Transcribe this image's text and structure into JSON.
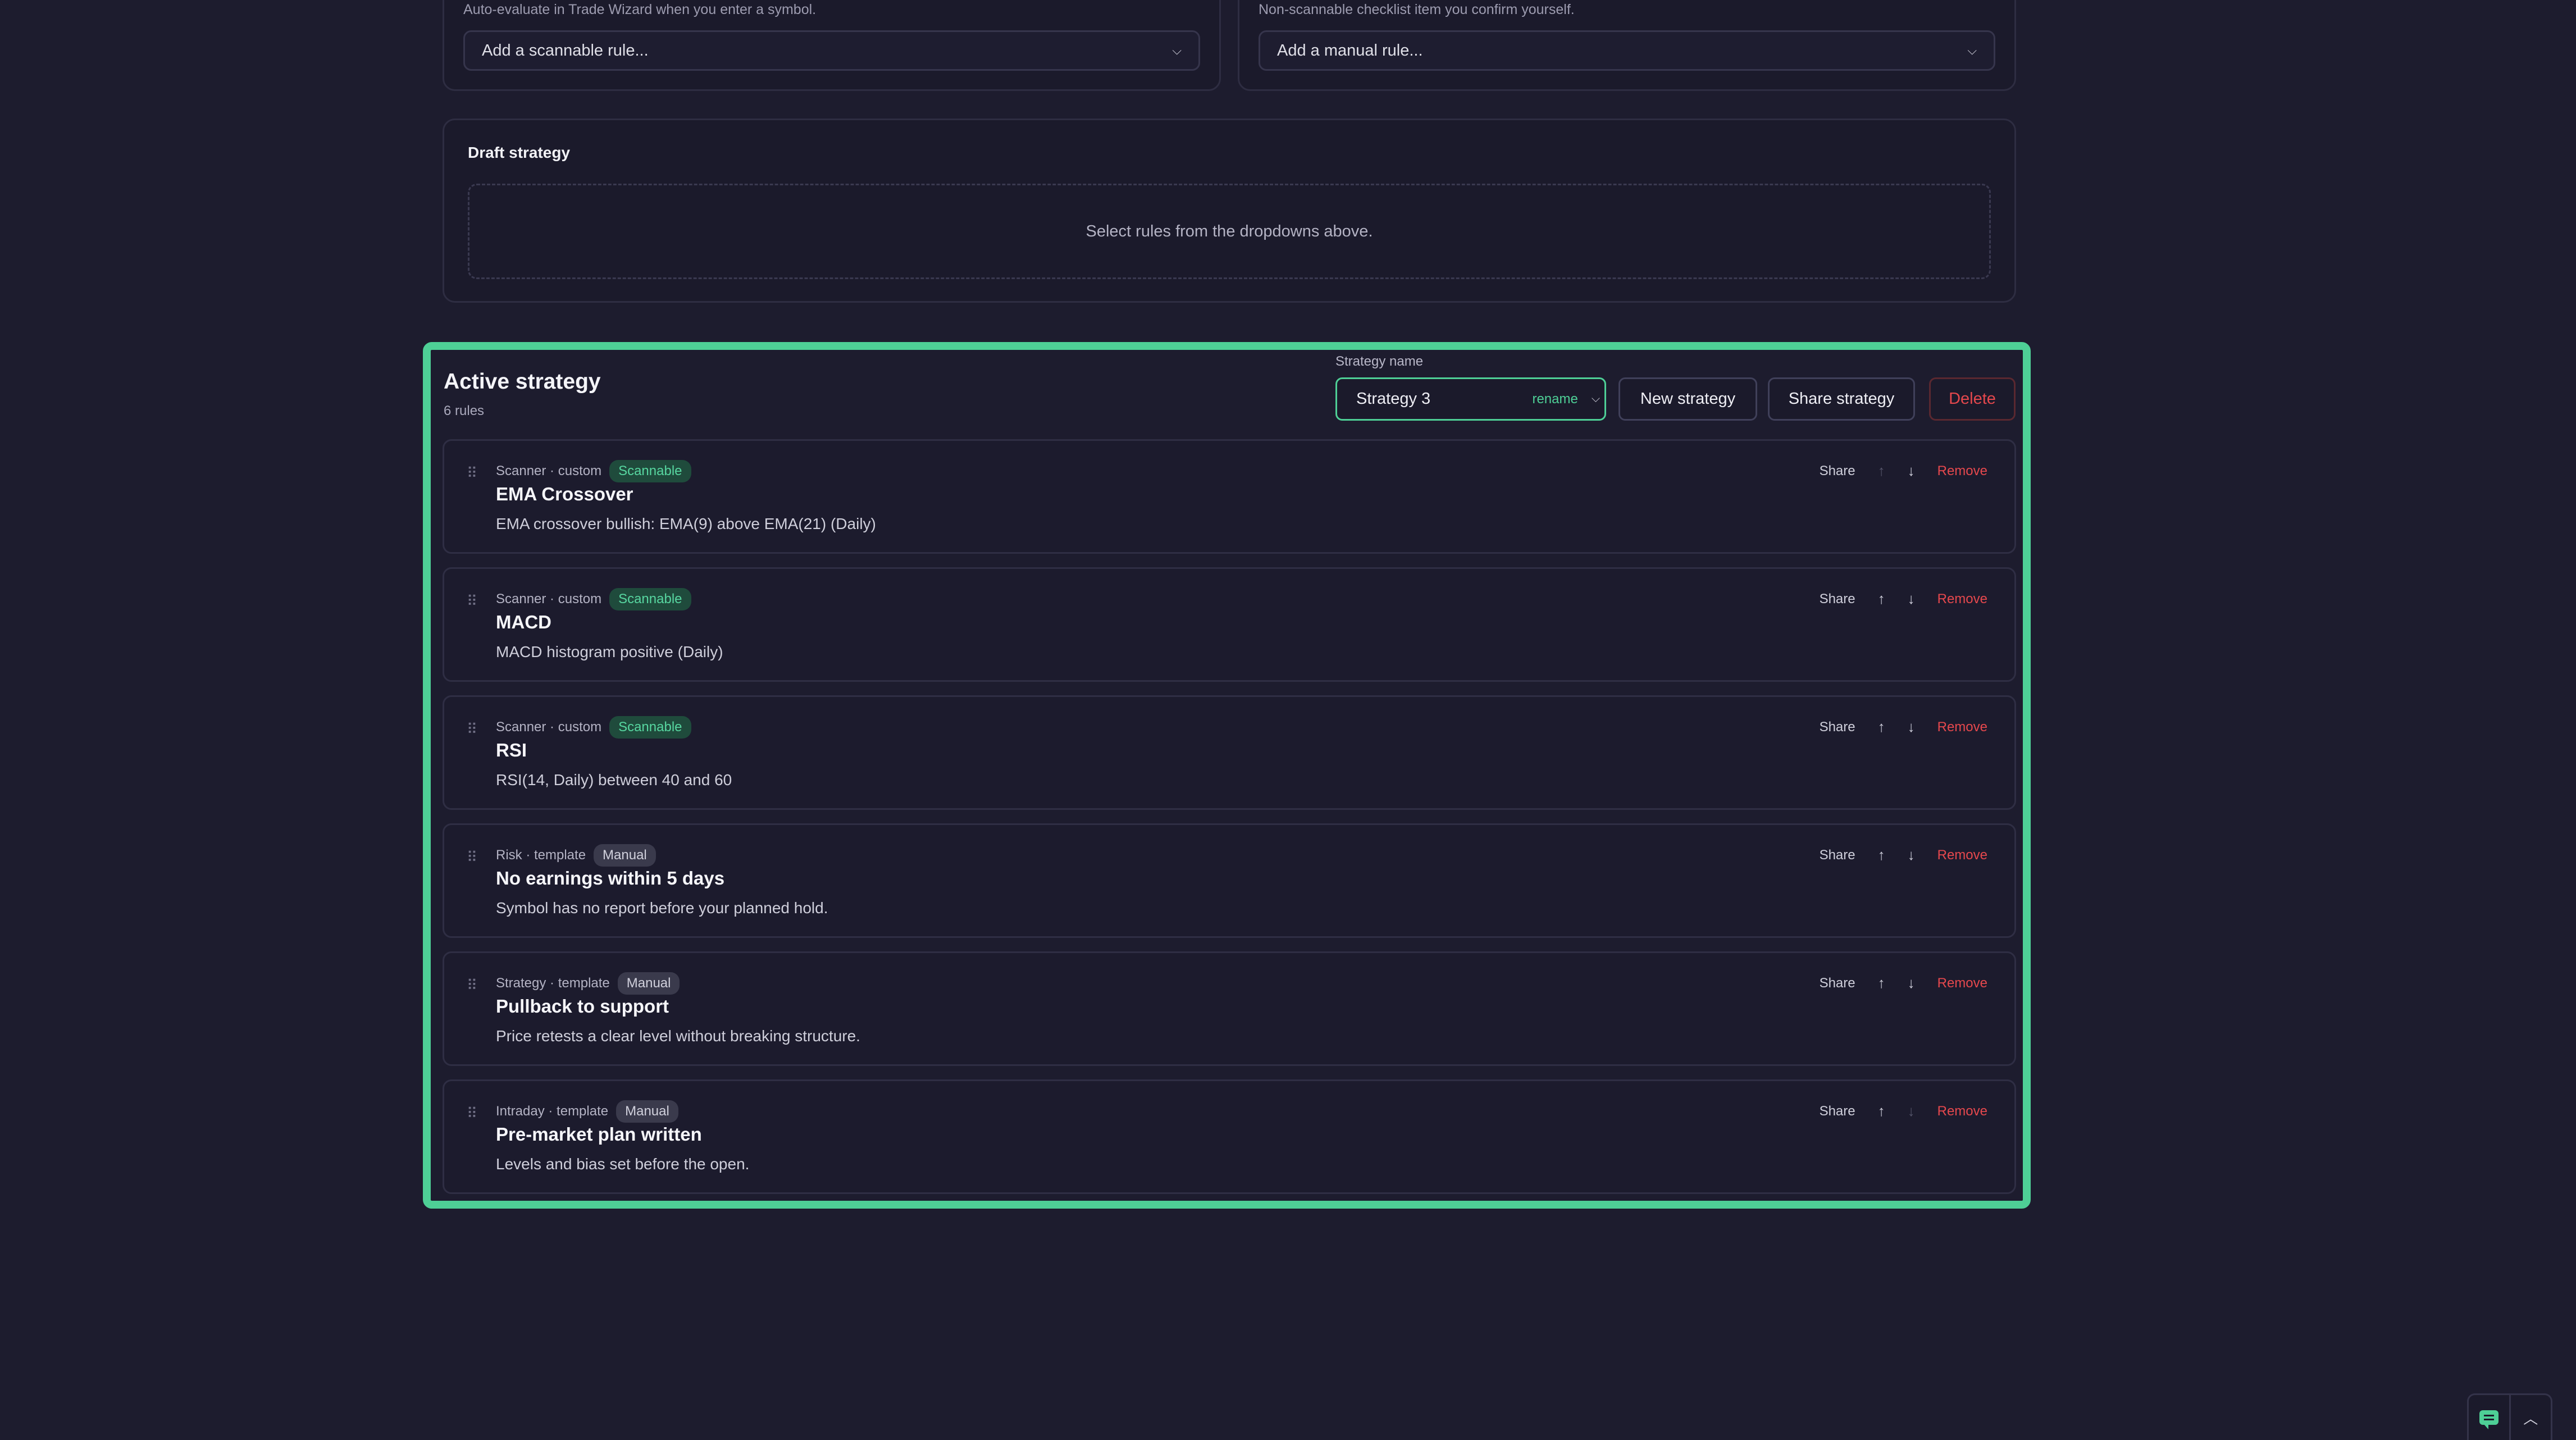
{
  "scannable_panel": {
    "hint": "Auto-evaluate in Trade Wizard when you enter a symbol.",
    "select_placeholder": "Add a scannable rule..."
  },
  "manual_panel": {
    "hint": "Non-scannable checklist item you confirm yourself.",
    "select_placeholder": "Add a manual rule..."
  },
  "draft": {
    "title": "Draft strategy",
    "empty_message": "Select rules from the dropdowns above."
  },
  "active": {
    "title": "Active strategy",
    "count": "6 rules",
    "name_label": "Strategy name",
    "name_value": "Strategy 3",
    "rename_label": "rename",
    "new_button": "New strategy",
    "share_button": "Share strategy",
    "delete_button": "Delete",
    "rules": [
      {
        "meta": "Scanner · custom",
        "badge": "Scannable",
        "badge_type": "scan",
        "title": "EMA Crossover",
        "desc": "EMA crossover bullish: EMA(9) above EMA(21) (Daily)",
        "up_disabled": true,
        "down_disabled": false
      },
      {
        "meta": "Scanner · custom",
        "badge": "Scannable",
        "badge_type": "scan",
        "title": "MACD",
        "desc": "MACD histogram positive (Daily)",
        "up_disabled": false,
        "down_disabled": false
      },
      {
        "meta": "Scanner · custom",
        "badge": "Scannable",
        "badge_type": "scan",
        "title": "RSI",
        "desc": "RSI(14, Daily) between 40 and 60",
        "up_disabled": false,
        "down_disabled": false
      },
      {
        "meta": "Risk · template",
        "badge": "Manual",
        "badge_type": "manual",
        "title": "No earnings within 5 days",
        "desc": "Symbol has no report before your planned hold.",
        "up_disabled": false,
        "down_disabled": false
      },
      {
        "meta": "Strategy · template",
        "badge": "Manual",
        "badge_type": "manual",
        "title": "Pullback to support",
        "desc": "Price retests a clear level without breaking structure.",
        "up_disabled": false,
        "down_disabled": false
      },
      {
        "meta": "Intraday · template",
        "badge": "Manual",
        "badge_type": "manual",
        "title": "Pre-market plan written",
        "desc": "Levels and bias set before the open.",
        "up_disabled": false,
        "down_disabled": true
      }
    ],
    "actions": {
      "share": "Share",
      "remove": "Remove",
      "up_glyph": "↑",
      "down_glyph": "↓",
      "grip_glyph": "⠿"
    }
  },
  "colors": {
    "accent": "#4ecf96",
    "danger": "#e5484d",
    "background": "#1d1c2e"
  }
}
